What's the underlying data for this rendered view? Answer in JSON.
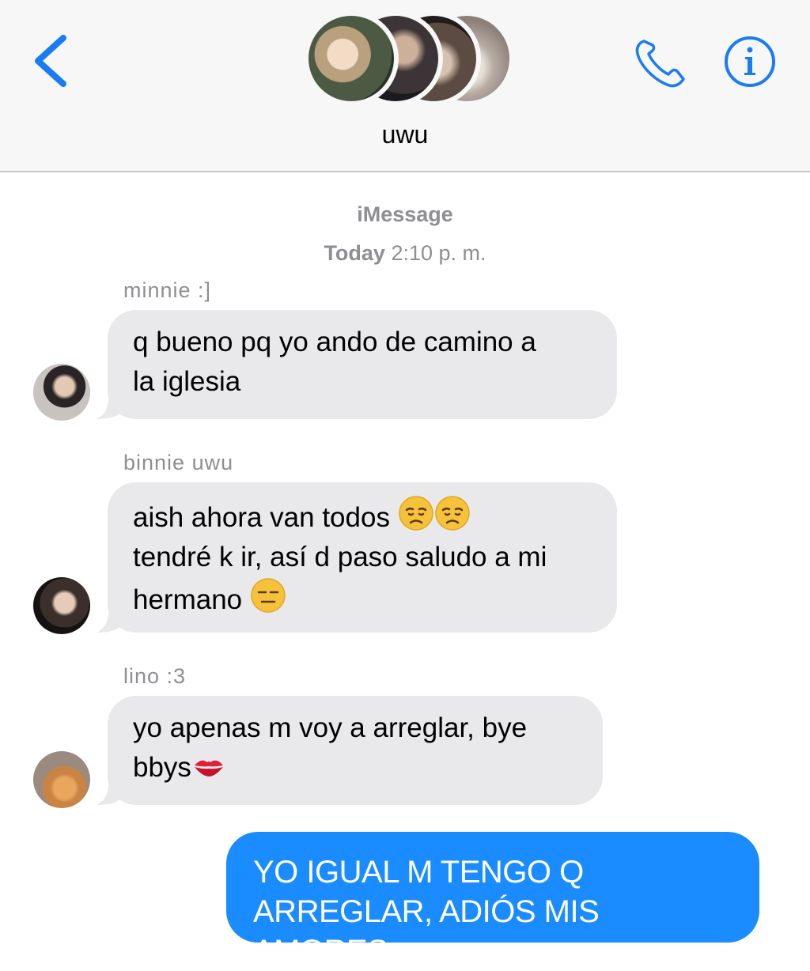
{
  "header": {
    "group_name": "uwu",
    "back_icon": "chevron-left-icon",
    "call_icon": "phone-icon",
    "info_icon": "info-icon",
    "accent_color": "#1a7cf5"
  },
  "thread": {
    "service": "iMessage",
    "timestamp_day": "Today",
    "timestamp_time": "2:10 p. m."
  },
  "messages": [
    {
      "sender": "minnie :]",
      "lines": [
        "q bueno pq yo ando de camino a",
        "la iglesia"
      ]
    },
    {
      "sender": "binnie uwu",
      "line1": "aish ahora van todos",
      "emoji1": "disappointed-face",
      "line2": "tendré k ir, así d paso saludo a mi",
      "line3": "hermano",
      "emoji3": "expressionless-face"
    },
    {
      "sender": "lino :3",
      "line1": "yo apenas m voy a arreglar, bye",
      "line2": "bbys",
      "emoji2": "kiss-mark"
    }
  ],
  "outgoing": {
    "lines": [
      "YO IGUAL M TENGO Q",
      "ARREGLAR, ADIÓS MIS AMORES"
    ],
    "bubble_color": "#1a8cff"
  }
}
